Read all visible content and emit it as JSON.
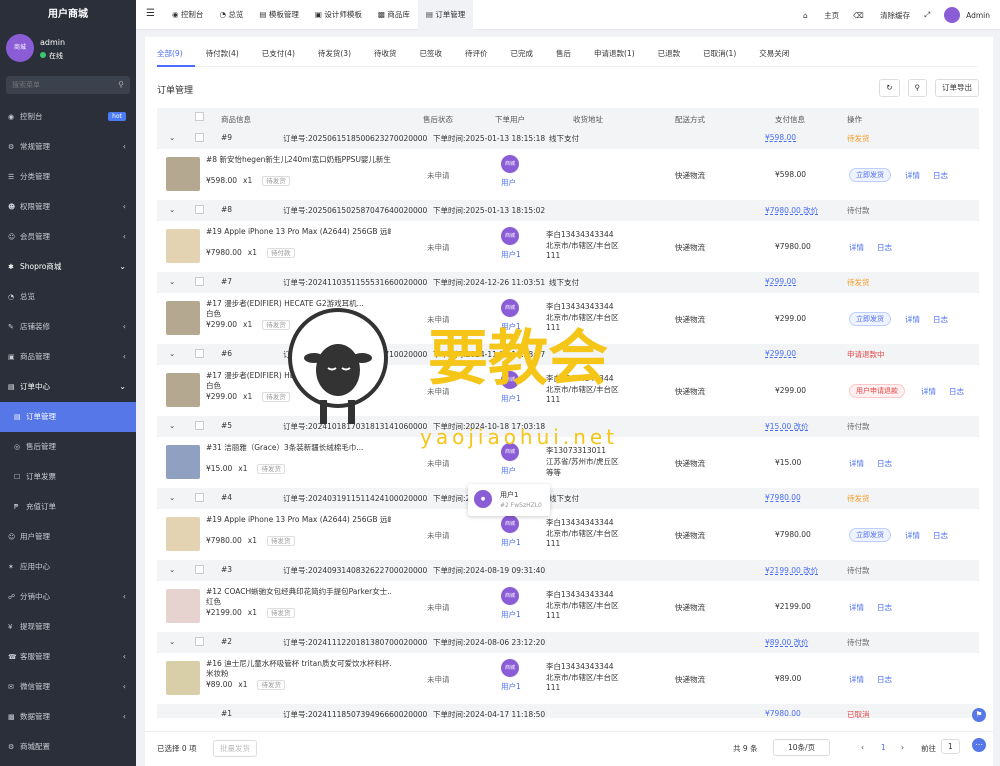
{
  "sidebar": {
    "brand": "用户商城",
    "user_name": "admin",
    "user_status": "在线",
    "avatar_text": "商城",
    "search_placeholder": "搜索菜单",
    "items": [
      {
        "label": "控制台",
        "badge": "hot"
      },
      {
        "label": "常规管理"
      },
      {
        "label": "分类管理"
      },
      {
        "label": "权限管理"
      },
      {
        "label": "会员管理"
      },
      {
        "label": "Shopro商城"
      },
      {
        "label": "总览"
      },
      {
        "label": "店铺装修"
      },
      {
        "label": "商品管理"
      },
      {
        "label": "订单中心"
      },
      {
        "label": "订单管理"
      },
      {
        "label": "售后管理"
      },
      {
        "label": "订单发票"
      },
      {
        "label": "充值订单"
      },
      {
        "label": "用户管理"
      },
      {
        "label": "应用中心"
      },
      {
        "label": "分销中心"
      },
      {
        "label": "提现管理"
      },
      {
        "label": "客服管理"
      },
      {
        "label": "微信管理"
      },
      {
        "label": "数据管理"
      },
      {
        "label": "商城配置"
      }
    ]
  },
  "topbar": {
    "tabs": [
      "控制台",
      "总览",
      "模板管理",
      "设计师模板",
      "商品库",
      "订单管理"
    ],
    "home": "主页",
    "clear_cache": "清除缓存",
    "admin": "Admin"
  },
  "status_tabs": [
    "全部(9)",
    "待付款(4)",
    "已支付(4)",
    "待发货(3)",
    "待收货",
    "已签收",
    "待评价",
    "已完成",
    "售后",
    "申请退款(1)",
    "已退款",
    "已取消(1)",
    "交易关闭"
  ],
  "page_title": "订单管理",
  "export_label": "订单导出",
  "columns": [
    "商品信息",
    "售后状态",
    "下单用户",
    "收货地址",
    "配送方式",
    "支付信息",
    "操作"
  ],
  "orders": [
    {
      "id": "#9",
      "sn": "订单号:2025061518500623270020000",
      "time": "下单时间:2025-01-13 18:15:18",
      "pay_type": "线下支付",
      "pay_total": "¥598.00",
      "status": "待发货",
      "status_color": "orange",
      "goods_name": "#8 新安怡hegen新生儿240ml宽口奶瓶PPSU婴儿新生...",
      "goods_attr": "",
      "price": "¥598.00",
      "qty": "x1",
      "tag": "待发货",
      "aftersale": "未申请",
      "user": "用户",
      "addr1": "",
      "addr2": "",
      "addr3": "",
      "dispatch": "快递物流",
      "amount": "¥598.00",
      "action": "立即发货",
      "action_type": "send",
      "thumb": "#b5a891"
    },
    {
      "id": "#8",
      "sn": "订单号:2025061502587047640020000",
      "time": "下单时间:2025-01-13 18:15:02",
      "pay_type": "",
      "pay_total": "¥7980.00 改价",
      "status": "待付款",
      "status_color": "gray",
      "goods_name": "#19 Apple iPhone 13 Pro Max (A2644) 256GB 远峰...",
      "goods_attr": "",
      "price": "¥7980.00",
      "qty": "x1",
      "tag": "待付款",
      "aftersale": "未申请",
      "user": "用户1",
      "addr1": "李白13434343344",
      "addr2": "北京市/市辖区/丰台区",
      "addr3": "111",
      "dispatch": "快递物流",
      "amount": "¥7980.00",
      "action": "",
      "action_type": "none",
      "thumb": "#e3d3b3"
    },
    {
      "id": "#7",
      "sn": "订单号:2024110351155531660020000",
      "time": "下单时间:2024-12-26 11:03:51",
      "pay_type": "线下支付",
      "pay_total": "¥299.00",
      "status": "待发货",
      "status_color": "orange",
      "goods_name": "#17 漫步者(EDIFIER) HECATE G2游戏耳机...",
      "goods_attr": "白色",
      "price": "¥299.00",
      "qty": "x1",
      "tag": "待发货",
      "aftersale": "未申请",
      "user": "用户1",
      "addr1": "李白13434343344",
      "addr2": "北京市/市辖区/丰台区",
      "addr3": "111",
      "dispatch": "快递物流",
      "amount": "¥299.00",
      "action": "立即发货",
      "action_type": "send",
      "thumb": "#b5a891"
    },
    {
      "id": "#6",
      "sn": "订单号:2024062807690981710020000",
      "time": "下单时间:2024-11-28 18:28:07",
      "pay_type": "",
      "pay_total": "¥299.00",
      "status": "申请退款中",
      "status_color": "red",
      "goods_name": "#17 漫步者(EDIFIER) HECATE G2游戏耳机...",
      "goods_attr": "白色",
      "price": "¥299.00",
      "qty": "x1",
      "tag": "待发货",
      "aftersale": "未申请",
      "user": "用户1",
      "addr1": "李白13434343344",
      "addr2": "北京市/市辖区/丰台区",
      "addr3": "111",
      "dispatch": "快递物流",
      "amount": "¥299.00",
      "action": "用户申请退款",
      "action_type": "refund",
      "thumb": "#b5a891"
    },
    {
      "id": "#5",
      "sn": "订单号:2024101817031813141060000",
      "time": "下单时间:2024-10-18 17:03:18",
      "pay_type": "",
      "pay_total": "¥15.00 改价",
      "status": "待付款",
      "status_color": "gray",
      "goods_name": "#31 洁丽雅（Grace）3条装新疆长绒棉毛巾...",
      "goods_attr": "",
      "price": "¥15.00",
      "qty": "x1",
      "tag": "待发货",
      "aftersale": "未申请",
      "user": "用户",
      "addr1": "李13073313011",
      "addr2": "江苏省/苏州市/虎丘区",
      "addr3": "等等",
      "dispatch": "快递物流",
      "amount": "¥15.00",
      "action": "",
      "action_type": "none",
      "thumb": "#8fa0c0"
    },
    {
      "id": "#4",
      "sn": "订单号:2024031911511424100020000",
      "time": "下单时间:2024-03-19 11:51:14",
      "pay_type": "线下支付",
      "pay_total": "¥7980.00",
      "status": "待发货",
      "status_color": "orange",
      "goods_name": "#19 Apple iPhone 13 Pro Max (A2644) 256GB 远峰...",
      "goods_attr": "",
      "price": "¥7980.00",
      "qty": "x1",
      "tag": "待发货",
      "aftersale": "未申请",
      "user": "用户1",
      "addr1": "李白13434343344",
      "addr2": "北京市/市辖区/丰台区",
      "addr3": "111",
      "dispatch": "快递物流",
      "amount": "¥7980.00",
      "action": "立即发货",
      "action_type": "send",
      "thumb": "#e3d3b3"
    },
    {
      "id": "#3",
      "sn": "订单号:2024093140832622700020000",
      "time": "下单时间:2024-08-19 09:31:40",
      "pay_type": "",
      "pay_total": "¥2199.00 改价",
      "status": "待付款",
      "status_color": "gray",
      "goods_name": "#12 COACH蜥驰女包经典印花简约手提包Parker女士...",
      "goods_attr": "红色",
      "price": "¥2199.00",
      "qty": "x1",
      "tag": "待发货",
      "aftersale": "未申请",
      "user": "用户1",
      "addr1": "李白13434343344",
      "addr2": "北京市/市辖区/丰台区",
      "addr3": "111",
      "dispatch": "快递物流",
      "amount": "¥2199.00",
      "action": "",
      "action_type": "none",
      "thumb": "#e6d2cf"
    },
    {
      "id": "#2",
      "sn": "订单号:2024111220181380700020000",
      "time": "下单时间:2024-08-06 23:12:20",
      "pay_type": "",
      "pay_total": "¥89.00 改价",
      "status": "待付款",
      "status_color": "gray",
      "goods_name": "#16 迪士尼儿童水杯吸管杯 tritan质女可爱饮水杯料杯...",
      "goods_attr": "米妆粉",
      "price": "¥89.00",
      "qty": "x1",
      "tag": "待发货",
      "aftersale": "未申请",
      "user": "用户1",
      "addr1": "李白13434343344",
      "addr2": "北京市/市辖区/丰台区",
      "addr3": "111",
      "dispatch": "快递物流",
      "amount": "¥89.00",
      "action": "",
      "action_type": "none",
      "thumb": "#d8cfa8"
    }
  ],
  "last_order": {
    "id": "#1",
    "sn": "订单号:2024111850739496660020000",
    "time": "下单时间:2024-04-17 11:18:50",
    "pay_total": "¥7980.00",
    "status": "已取消"
  },
  "row_links": {
    "detail": "详情",
    "log": "日志"
  },
  "float_user": {
    "name": "用户1",
    "sub": "#2 FwSzHZL0"
  },
  "footer": {
    "selected": "已选择 0 项",
    "batch_send": "批量发货",
    "total": "共 9 条",
    "page_size": "10条/页",
    "page": "1",
    "goto": "前往",
    "goto_value": "1"
  },
  "watermark": {
    "text": "要教会",
    "url": "yaojiaohui.net"
  },
  "colors": {
    "accent": "#4a6cf7",
    "sidebar": "#2b2f3a",
    "active": "#5677e8",
    "orange": "#f59a23",
    "red": "#e54545"
  }
}
